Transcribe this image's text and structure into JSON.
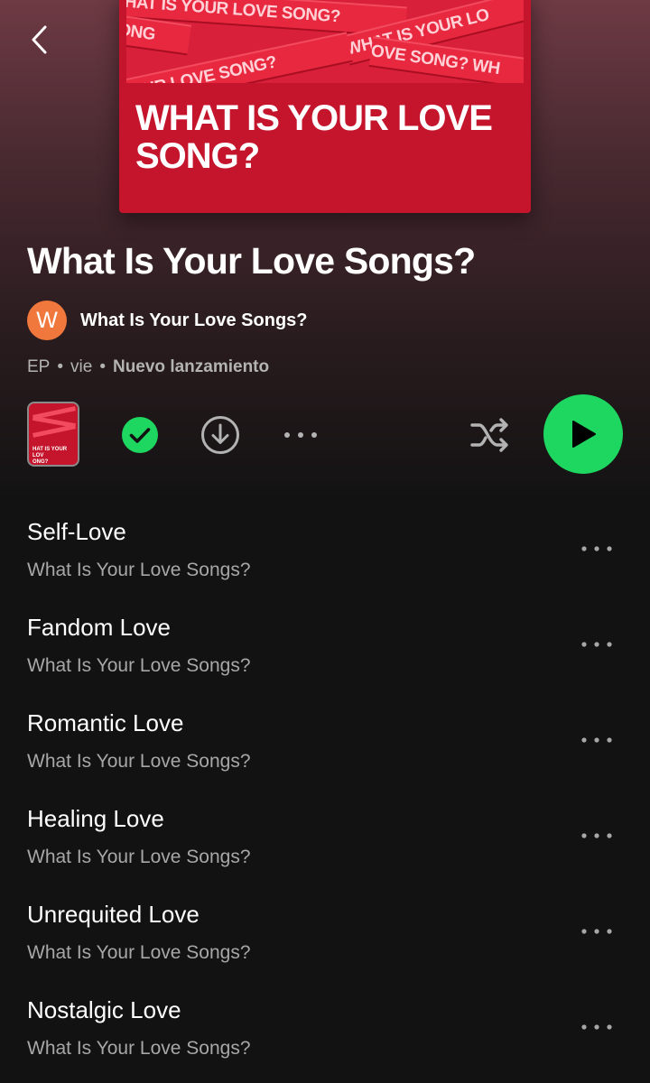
{
  "header": {
    "back_icon": "chevron-left-icon"
  },
  "cover": {
    "title": "WHAT IS YOUR LOVE SONG?",
    "tape_texts": [
      "WHAT IS YOUR LOVE SONG?",
      "ONG",
      "WHAT IS YOUR LO",
      "YOUR LOVE SONG?",
      "OVE SONG? WH"
    ],
    "color": "#c4152c"
  },
  "album": {
    "title": "What Is Your Love Songs?",
    "artist_initial": "W",
    "artist_name": "What Is Your Love Songs?",
    "avatar_color": "#f0783c",
    "type": "EP",
    "day": "vie",
    "release_label": "Nuevo lanzamiento"
  },
  "controls": {
    "thumb_text": "HAT IS YOUR LOV\nONG?",
    "saved_icon": "check-circle-icon",
    "download_icon": "download-circle-icon",
    "more_icon": "more-horizontal-icon",
    "shuffle_icon": "shuffle-icon",
    "play_icon": "play-icon",
    "accent_color": "#1ed760"
  },
  "tracks": [
    {
      "title": "Self-Love",
      "artist": "What Is Your Love Songs?"
    },
    {
      "title": "Fandom Love",
      "artist": "What Is Your Love Songs?"
    },
    {
      "title": "Romantic Love",
      "artist": "What Is Your Love Songs?"
    },
    {
      "title": "Healing Love",
      "artist": "What Is Your Love Songs?"
    },
    {
      "title": "Unrequited Love",
      "artist": "What Is Your Love Songs?"
    },
    {
      "title": "Nostalgic Love",
      "artist": "What Is Your Love Songs?"
    }
  ]
}
